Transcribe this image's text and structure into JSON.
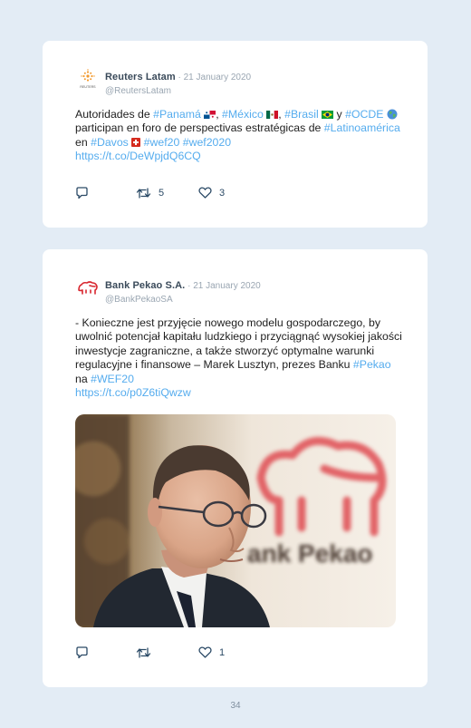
{
  "tweets": [
    {
      "author": "Reuters Latam",
      "date": " · 21 January 2020",
      "handle": "@ReutersLatam",
      "avatar_text": "REUTERS",
      "text": {
        "p1": "Autoridades de ",
        "tag_panama": "#Panamá",
        "p2": ", ",
        "tag_mexico": "#México",
        "p3": ", ",
        "tag_brasil": "#Brasil",
        "p4": " y ",
        "tag_ocde": "#OCDE",
        "p5": " participan en foro de perspectivas estratégicas de ",
        "tag_latam": "#Latinoamérica",
        "p6": " en ",
        "tag_davos": "#Davos",
        "p7": " ",
        "tag_wef20": "#wef20",
        "p8": " ",
        "tag_wef2020": "#wef2020",
        "url": "https://t.co/DeWpjdQ6CQ"
      },
      "retweets": "5",
      "likes": "3"
    },
    {
      "author": "Bank Pekao S.A.",
      "date": " · 21 January 2020",
      "handle": "@BankPekaoSA",
      "text": {
        "p1": "- Konieczne jest przyjęcie nowego modelu gospodarczego, by uwolnić potencjał kapitału ludzkiego i przyciągnąć wysokiej jakości inwestycje zagraniczne, a także stworzyć optymalne warunki regulacyjne i finansowe – Marek Lusztyn, prezes Banku ",
        "tag_pekao": "#Pekao",
        "p2": " na ",
        "tag_wef20": "#WEF20",
        "url": "https://t.co/p0Z6tiQwzw"
      },
      "photo_sign": "ank Pekao",
      "retweets": "",
      "likes": "1"
    }
  ],
  "page_number": "34",
  "colors": {
    "link": "#55acee",
    "background": "#e3ecf5",
    "icon": "#2b4a66"
  }
}
